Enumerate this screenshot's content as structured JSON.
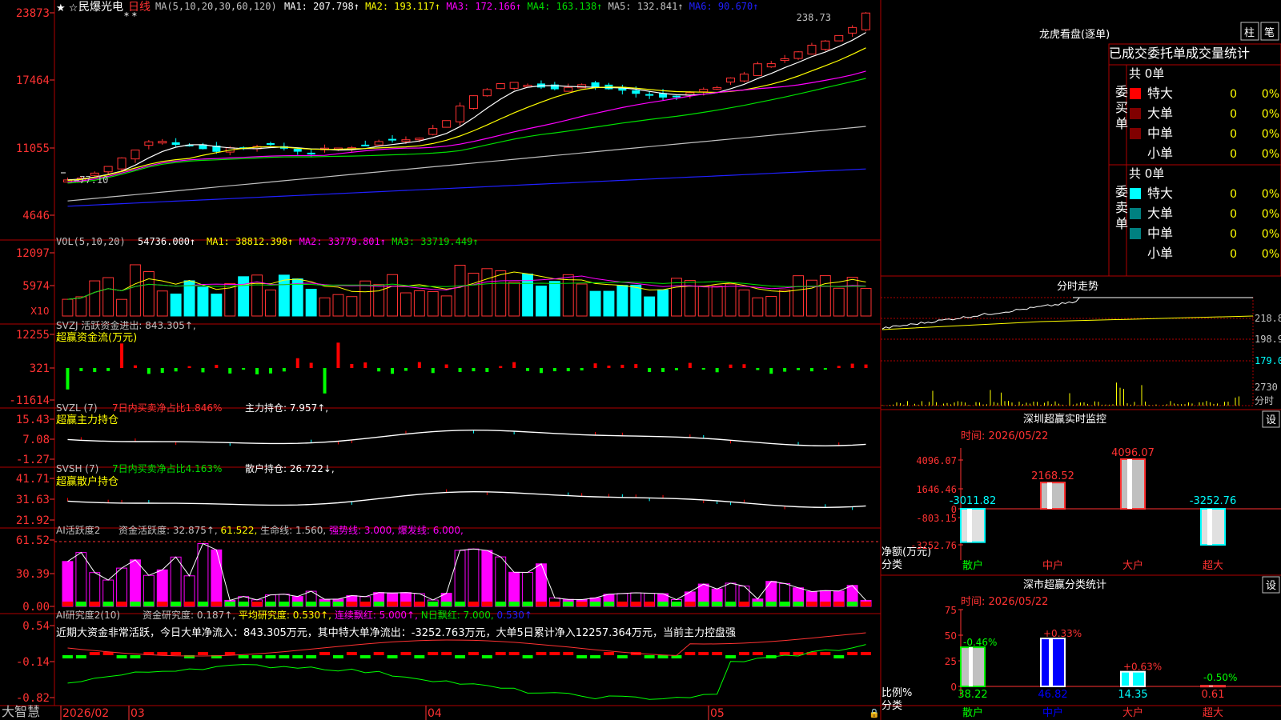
{
  "colors": {
    "up": "#ff3232",
    "down": "#00ffff",
    "grid": "#b00000",
    "axis": "#ff3232",
    "ma1": "#ffffff",
    "ma2": "#ffff00",
    "ma3": "#ff00ff",
    "ma4": "#00e000",
    "ma5": "#c0c0c0",
    "ma6": "#2020ff",
    "vol_ma1": "#ffff00",
    "vol_ma2": "#ff00ff",
    "vol_ma3": "#00e000",
    "inflow": "#ff0000",
    "outflow": "#00ff00",
    "magenta": "#ff00ff"
  },
  "header": {
    "stars": "★ ☆",
    "stock_name": "民爆光电",
    "period": "日线",
    "ma_params": "MA(5,10,20,30,60,120)",
    "ma_items": [
      {
        "label": "MA1: 207.798↑",
        "color": "ma1"
      },
      {
        "label": "MA2: 193.117↑",
        "color": "ma2"
      },
      {
        "label": "MA3: 172.166↑",
        "color": "ma3"
      },
      {
        "label": "MA4: 163.138↑",
        "color": "ma4"
      },
      {
        "label": "MA5: 132.841↑",
        "color": "ma5"
      },
      {
        "label": "MA6: 90.670↑",
        "color": "ma6"
      }
    ]
  },
  "price_panel": {
    "y_labels": [
      "23873",
      "17464",
      "11055",
      "4646"
    ],
    "high_label": "238.73",
    "low_label": "←77.10",
    "star_marks": "* *"
  },
  "volume_panel": {
    "y_labels": [
      "12097",
      "5974"
    ],
    "unit": "X10",
    "title": "VOL(5,10,20)",
    "value": "54736.000↑",
    "items": [
      {
        "label": "MA1: 38812.398↑",
        "color": "vol_ma1"
      },
      {
        "label": "MA2: 33779.801↑",
        "color": "vol_ma2"
      },
      {
        "label": "MA3: 33719.449↑",
        "color": "vol_ma3"
      }
    ]
  },
  "svzj_panel": {
    "y_labels": [
      "12255",
      "321",
      "-11614"
    ],
    "title": "SVZJ  活跃资金进出: 843.305↑,",
    "subtitle": "超赢资金流(万元)"
  },
  "svzl_panel": {
    "y_labels": [
      "15.43",
      "7.08",
      "-1.27"
    ],
    "title": "SVZL (7)",
    "metric_red": "7日内买卖净占比1.846%",
    "metric_white": "主力持仓: 7.957↑,",
    "subtitle": "超赢主力持仓"
  },
  "svsh_panel": {
    "y_labels": [
      "41.71",
      "31.63",
      "21.92"
    ],
    "title": "SVSH (7)",
    "metric_green": "7日内买卖净占比4.163%",
    "metric_white": "散户持仓: 26.722↓,",
    "subtitle": "超赢散户持仓"
  },
  "ai_active_panel": {
    "y_labels": [
      "61.52",
      "30.39",
      "0.00"
    ],
    "title": "AI活跃度2",
    "items": [
      {
        "label": "资金活跃度: 32.875↑,",
        "color": "#c0c0c0"
      },
      {
        "label": "61.522,",
        "color": "#ffff00"
      },
      {
        "label": "生命线: 1.560,",
        "color": "#c0c0c0"
      },
      {
        "label": "强势线: 3.000,",
        "color": "#ff00ff"
      },
      {
        "label": "爆发线: 6.000,",
        "color": "#ff00ff"
      }
    ]
  },
  "ai_research_panel": {
    "y_labels": [
      "0.54",
      "-0.14",
      "-0.82"
    ],
    "title": "AI研究度2(10)",
    "items": [
      {
        "label": "资金研究度: 0.187↑,",
        "color": "#c0c0c0"
      },
      {
        "label": "平均研究度: 0.530↑,",
        "color": "#ffff00"
      },
      {
        "label": "连续飘红: 5.000↑,",
        "color": "#ff00ff"
      },
      {
        "label": "N日飘红: 7.000,",
        "color": "#00e000"
      },
      {
        "label": "0.530↑",
        "color": "#2020ff"
      }
    ],
    "comment": "近期大资金非常活跃，今日大单净流入：843.305万元，其中特大单净流出：-3252.763万元，大单5日累计净入12257.364万元，当前主力控盘强"
  },
  "x_axis": {
    "brand": "大智慧",
    "labels": [
      {
        "text": "2026/02"
      },
      {
        "text": "03"
      },
      {
        "text": "04"
      },
      {
        "text": "05"
      }
    ]
  },
  "dragon": {
    "title": "龙虎看盘(逐单)",
    "btn1": "柱",
    "btn2": "笔",
    "tabs_title": "已成交委托单成交量统计",
    "buy_label": "委买单",
    "sell_label": "委卖单",
    "buy_total": "共 0单",
    "sell_total": "共 0单",
    "buy_rows": [
      {
        "name": "特大",
        "qty": "0",
        "pct": "0%",
        "color": "#ff0000"
      },
      {
        "name": "大单",
        "qty": "0",
        "pct": "0%",
        "color": "#800000"
      },
      {
        "name": "中单",
        "qty": "0",
        "pct": "0%",
        "color": "#800000"
      },
      {
        "name": "小单",
        "qty": "0",
        "pct": "0%",
        "color": ""
      }
    ],
    "sell_rows": [
      {
        "name": "特大",
        "qty": "0",
        "pct": "0%",
        "color": "#00ffff"
      },
      {
        "name": "大单",
        "qty": "0",
        "pct": "0%",
        "color": "#008080"
      },
      {
        "name": "中单",
        "qty": "0",
        "pct": "0%",
        "color": "#008080"
      },
      {
        "name": "小单",
        "qty": "0",
        "pct": "0%",
        "color": ""
      }
    ]
  },
  "intraday": {
    "title": "分时走势",
    "price_labels": [
      "218.8",
      "198.9",
      "179.0"
    ],
    "vol_label": "2730",
    "vol_unit": "分时"
  },
  "monitor": {
    "title": "深圳超赢实时监控",
    "set": "设",
    "time": "时间: 2026/05/22",
    "y_labels": [
      "4096.07",
      "1646.46",
      "0",
      "-803.15",
      "-3252.76"
    ],
    "unit_label": "净额(万元)",
    "cat_label": "分类",
    "bars": [
      {
        "cat": "散户",
        "value": -3011.82,
        "label": "-3011.82"
      },
      {
        "cat": "中户",
        "value": 2168.52,
        "label": "2168.52"
      },
      {
        "cat": "大户",
        "value": 4096.07,
        "label": "4096.07"
      },
      {
        "cat": "超大",
        "value": -3252.76,
        "label": "-3252.76"
      }
    ]
  },
  "classify": {
    "title": "深市超赢分类统计",
    "set": "设",
    "time": "时间: 2026/05/22",
    "y_labels": [
      "75",
      "50",
      "25",
      "0"
    ],
    "unit_label": "比例%",
    "cat_label": "分类",
    "bars": [
      {
        "cat": "散户",
        "value": 38.22,
        "value_label": "38.22",
        "change": "-0.46%"
      },
      {
        "cat": "中户",
        "value": 46.82,
        "value_label": "46.82",
        "change": "+0.33%"
      },
      {
        "cat": "大户",
        "value": 14.35,
        "value_label": "14.35",
        "change": "+0.63%"
      },
      {
        "cat": "超大",
        "value": 0.61,
        "value_label": "0.61",
        "change": "-0.50%"
      }
    ]
  }
}
